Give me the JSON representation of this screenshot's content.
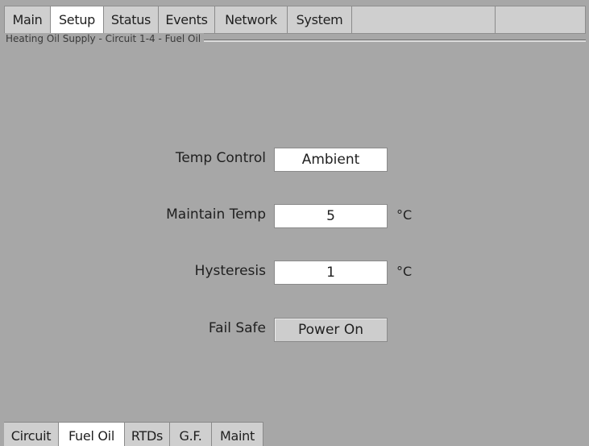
{
  "top_tabs": [
    {
      "label": "Main",
      "active": false
    },
    {
      "label": "Setup",
      "active": true
    },
    {
      "label": "Status",
      "active": false
    },
    {
      "label": "Events",
      "active": false
    },
    {
      "label": "Network",
      "active": false
    },
    {
      "label": "System",
      "active": false
    }
  ],
  "group": {
    "title": "Heating Oil Supply - Circuit 1-4 - Fuel Oil"
  },
  "form": {
    "temp_control": {
      "label": "Temp Control",
      "value": "Ambient"
    },
    "maintain_temp": {
      "label": "Maintain Temp",
      "value": "5",
      "unit": "°C"
    },
    "hysteresis": {
      "label": "Hysteresis",
      "value": "1",
      "unit": "°C"
    },
    "fail_safe": {
      "label": "Fail Safe",
      "value": "Power On"
    }
  },
  "bottom_tabs": [
    {
      "label": "Circuit",
      "active": false
    },
    {
      "label": "Fuel Oil",
      "active": true
    },
    {
      "label": "RTDs",
      "active": false
    },
    {
      "label": "G.F.",
      "active": false
    },
    {
      "label": "Maint",
      "active": false
    }
  ],
  "colors": {
    "panel": "#a7a7a7",
    "tab": "#cfcfcf",
    "active_tab": "#ffffff"
  }
}
